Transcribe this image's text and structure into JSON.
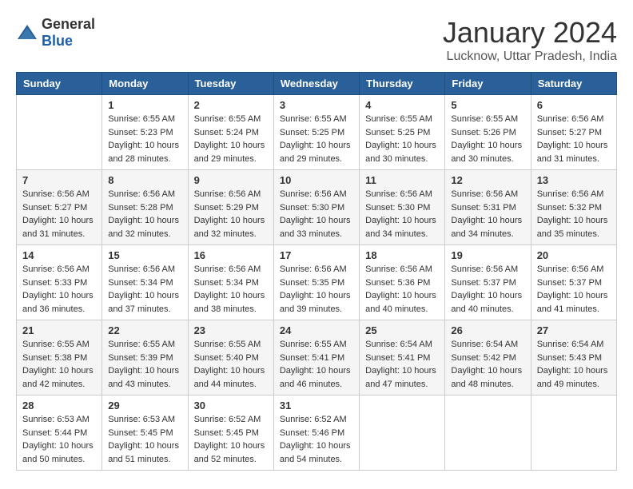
{
  "logo": {
    "general": "General",
    "blue": "Blue"
  },
  "title": "January 2024",
  "location": "Lucknow, Uttar Pradesh, India",
  "days_of_week": [
    "Sunday",
    "Monday",
    "Tuesday",
    "Wednesday",
    "Thursday",
    "Friday",
    "Saturday"
  ],
  "weeks": [
    [
      {
        "day": "",
        "info": ""
      },
      {
        "day": "1",
        "info": "Sunrise: 6:55 AM\nSunset: 5:23 PM\nDaylight: 10 hours\nand 28 minutes."
      },
      {
        "day": "2",
        "info": "Sunrise: 6:55 AM\nSunset: 5:24 PM\nDaylight: 10 hours\nand 29 minutes."
      },
      {
        "day": "3",
        "info": "Sunrise: 6:55 AM\nSunset: 5:25 PM\nDaylight: 10 hours\nand 29 minutes."
      },
      {
        "day": "4",
        "info": "Sunrise: 6:55 AM\nSunset: 5:25 PM\nDaylight: 10 hours\nand 30 minutes."
      },
      {
        "day": "5",
        "info": "Sunrise: 6:55 AM\nSunset: 5:26 PM\nDaylight: 10 hours\nand 30 minutes."
      },
      {
        "day": "6",
        "info": "Sunrise: 6:56 AM\nSunset: 5:27 PM\nDaylight: 10 hours\nand 31 minutes."
      }
    ],
    [
      {
        "day": "7",
        "info": "Sunrise: 6:56 AM\nSunset: 5:27 PM\nDaylight: 10 hours\nand 31 minutes."
      },
      {
        "day": "8",
        "info": "Sunrise: 6:56 AM\nSunset: 5:28 PM\nDaylight: 10 hours\nand 32 minutes."
      },
      {
        "day": "9",
        "info": "Sunrise: 6:56 AM\nSunset: 5:29 PM\nDaylight: 10 hours\nand 32 minutes."
      },
      {
        "day": "10",
        "info": "Sunrise: 6:56 AM\nSunset: 5:30 PM\nDaylight: 10 hours\nand 33 minutes."
      },
      {
        "day": "11",
        "info": "Sunrise: 6:56 AM\nSunset: 5:30 PM\nDaylight: 10 hours\nand 34 minutes."
      },
      {
        "day": "12",
        "info": "Sunrise: 6:56 AM\nSunset: 5:31 PM\nDaylight: 10 hours\nand 34 minutes."
      },
      {
        "day": "13",
        "info": "Sunrise: 6:56 AM\nSunset: 5:32 PM\nDaylight: 10 hours\nand 35 minutes."
      }
    ],
    [
      {
        "day": "14",
        "info": "Sunrise: 6:56 AM\nSunset: 5:33 PM\nDaylight: 10 hours\nand 36 minutes."
      },
      {
        "day": "15",
        "info": "Sunrise: 6:56 AM\nSunset: 5:34 PM\nDaylight: 10 hours\nand 37 minutes."
      },
      {
        "day": "16",
        "info": "Sunrise: 6:56 AM\nSunset: 5:34 PM\nDaylight: 10 hours\nand 38 minutes."
      },
      {
        "day": "17",
        "info": "Sunrise: 6:56 AM\nSunset: 5:35 PM\nDaylight: 10 hours\nand 39 minutes."
      },
      {
        "day": "18",
        "info": "Sunrise: 6:56 AM\nSunset: 5:36 PM\nDaylight: 10 hours\nand 40 minutes."
      },
      {
        "day": "19",
        "info": "Sunrise: 6:56 AM\nSunset: 5:37 PM\nDaylight: 10 hours\nand 40 minutes."
      },
      {
        "day": "20",
        "info": "Sunrise: 6:56 AM\nSunset: 5:37 PM\nDaylight: 10 hours\nand 41 minutes."
      }
    ],
    [
      {
        "day": "21",
        "info": "Sunrise: 6:55 AM\nSunset: 5:38 PM\nDaylight: 10 hours\nand 42 minutes."
      },
      {
        "day": "22",
        "info": "Sunrise: 6:55 AM\nSunset: 5:39 PM\nDaylight: 10 hours\nand 43 minutes."
      },
      {
        "day": "23",
        "info": "Sunrise: 6:55 AM\nSunset: 5:40 PM\nDaylight: 10 hours\nand 44 minutes."
      },
      {
        "day": "24",
        "info": "Sunrise: 6:55 AM\nSunset: 5:41 PM\nDaylight: 10 hours\nand 46 minutes."
      },
      {
        "day": "25",
        "info": "Sunrise: 6:54 AM\nSunset: 5:41 PM\nDaylight: 10 hours\nand 47 minutes."
      },
      {
        "day": "26",
        "info": "Sunrise: 6:54 AM\nSunset: 5:42 PM\nDaylight: 10 hours\nand 48 minutes."
      },
      {
        "day": "27",
        "info": "Sunrise: 6:54 AM\nSunset: 5:43 PM\nDaylight: 10 hours\nand 49 minutes."
      }
    ],
    [
      {
        "day": "28",
        "info": "Sunrise: 6:53 AM\nSunset: 5:44 PM\nDaylight: 10 hours\nand 50 minutes."
      },
      {
        "day": "29",
        "info": "Sunrise: 6:53 AM\nSunset: 5:45 PM\nDaylight: 10 hours\nand 51 minutes."
      },
      {
        "day": "30",
        "info": "Sunrise: 6:52 AM\nSunset: 5:45 PM\nDaylight: 10 hours\nand 52 minutes."
      },
      {
        "day": "31",
        "info": "Sunrise: 6:52 AM\nSunset: 5:46 PM\nDaylight: 10 hours\nand 54 minutes."
      },
      {
        "day": "",
        "info": ""
      },
      {
        "day": "",
        "info": ""
      },
      {
        "day": "",
        "info": ""
      }
    ]
  ]
}
